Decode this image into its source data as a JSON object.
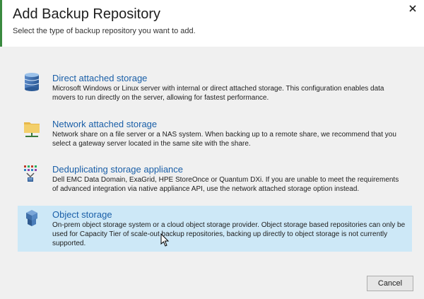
{
  "dialog": {
    "title": "Add Backup Repository",
    "subtitle": "Select the type of backup repository you want to add.",
    "close_icon": "close-icon"
  },
  "options": [
    {
      "title": "Direct attached storage",
      "description": "Microsoft Windows or Linux server with internal or direct attached storage. This configuration enables data movers to run directly on the server, allowing for fastest performance.",
      "icon": "database-icon",
      "selected": false
    },
    {
      "title": "Network attached storage",
      "description": "Network share on a file server or a NAS system. When backing up to a remote share, we recommend that you select a gateway server located in the same site with the share.",
      "icon": "network-folder-icon",
      "selected": false
    },
    {
      "title": "Deduplicating storage appliance",
      "description": "Dell EMC Data Domain, ExaGrid, HPE StoreOnce or Quantum DXi. If you are unable to meet the requirements of advanced integration via native appliance API, use the network attached storage option instead.",
      "icon": "dedup-appliance-icon",
      "selected": false
    },
    {
      "title": "Object storage",
      "description": "On-prem object storage system or a cloud object storage provider. Object storage based repositories can only be used for Capacity Tier of scale-out backup repositories, backing up directly to object storage is not currently supported.",
      "icon": "object-storage-icon",
      "selected": true
    }
  ],
  "footer": {
    "cancel_label": "Cancel"
  },
  "colors": {
    "accent": "#3a8a3f",
    "link": "#1a5fa8",
    "selected_bg": "#cde8f7"
  }
}
